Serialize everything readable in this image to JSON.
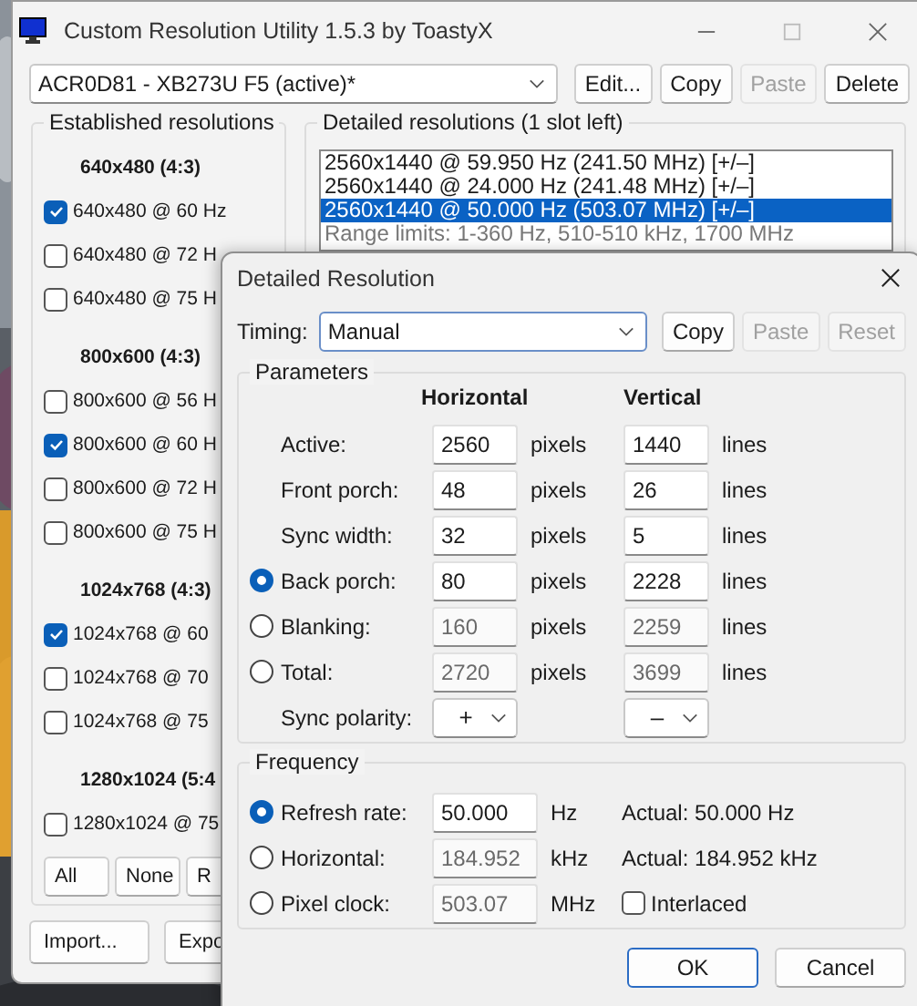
{
  "window": {
    "title": "Custom Resolution Utility 1.5.3 by ToastyX"
  },
  "monitor_select": {
    "value": "ACR0D81 - XB273U F5 (active)*"
  },
  "top_buttons": [
    {
      "label": "Edit...",
      "disabled": false
    },
    {
      "label": "Copy",
      "disabled": false
    },
    {
      "label": "Paste",
      "disabled": true
    },
    {
      "label": "Delete",
      "disabled": false
    }
  ],
  "established": {
    "title": "Established resolutions",
    "groups": [
      {
        "heading": "640x480 (4:3)",
        "items": [
          {
            "label": "640x480 @ 60 Hz",
            "checked": true
          },
          {
            "label": "640x480 @ 72 H",
            "checked": false
          },
          {
            "label": "640x480 @ 75 H",
            "checked": false
          }
        ]
      },
      {
        "heading": "800x600 (4:3)",
        "items": [
          {
            "label": "800x600 @ 56 H",
            "checked": false
          },
          {
            "label": "800x600 @ 60 H",
            "checked": true
          },
          {
            "label": "800x600 @ 72 H",
            "checked": false
          },
          {
            "label": "800x600 @ 75 H",
            "checked": false
          }
        ]
      },
      {
        "heading": "1024x768 (4:3)",
        "items": [
          {
            "label": "1024x768 @ 60",
            "checked": true
          },
          {
            "label": "1024x768 @ 70",
            "checked": false
          },
          {
            "label": "1024x768 @ 75",
            "checked": false
          }
        ]
      },
      {
        "heading": "1280x1024 (5:4",
        "items": [
          {
            "label": "1280x1024 @ 75",
            "checked": false
          }
        ]
      }
    ],
    "buttons": [
      {
        "label": "All"
      },
      {
        "label": "None"
      },
      {
        "label": "R"
      }
    ]
  },
  "detailed": {
    "title": "Detailed resolutions (1 slot left)",
    "items": [
      {
        "label": "2560x1440 @ 59.950 Hz (241.50 MHz) [+/–]",
        "selected": false
      },
      {
        "label": "2560x1440 @ 24.000 Hz (241.48 MHz) [+/–]",
        "selected": false
      },
      {
        "label": "2560x1440 @ 50.000 Hz (503.07 MHz) [+/–]",
        "selected": true
      }
    ],
    "range_limits": "Range limits: 1-360 Hz, 510-510 kHz, 1700 MHz"
  },
  "bottom_buttons": [
    {
      "label": "Import..."
    },
    {
      "label": "Expo"
    }
  ],
  "dialog": {
    "title": "Detailed Resolution",
    "timing": {
      "label": "Timing:",
      "value": "Manual"
    },
    "timing_buttons": [
      {
        "label": "Copy",
        "disabled": false
      },
      {
        "label": "Paste",
        "disabled": true
      },
      {
        "label": "Reset",
        "disabled": true
      }
    ],
    "parameters": {
      "title": "Parameters",
      "columns": [
        "Horizontal",
        "Vertical"
      ],
      "rows": [
        {
          "kind": "plain",
          "label": "Active:",
          "h": "2560",
          "h_unit": "pixels",
          "v": "1440",
          "v_unit": "lines",
          "disabled": false
        },
        {
          "kind": "plain",
          "label": "Front porch:",
          "h": "48",
          "h_unit": "pixels",
          "v": "26",
          "v_unit": "lines",
          "disabled": false
        },
        {
          "kind": "plain",
          "label": "Sync width:",
          "h": "32",
          "h_unit": "pixels",
          "v": "5",
          "v_unit": "lines",
          "disabled": false
        },
        {
          "kind": "radio",
          "selected": true,
          "label": "Back porch:",
          "h": "80",
          "h_unit": "pixels",
          "v": "2228",
          "v_unit": "lines",
          "disabled": false
        },
        {
          "kind": "radio",
          "selected": false,
          "label": "Blanking:",
          "h": "160",
          "h_unit": "pixels",
          "v": "2259",
          "v_unit": "lines",
          "disabled": true
        },
        {
          "kind": "radio",
          "selected": false,
          "label": "Total:",
          "h": "2720",
          "h_unit": "pixels",
          "v": "3699",
          "v_unit": "lines",
          "disabled": true
        }
      ],
      "sync_polarity": {
        "label": "Sync polarity:",
        "h": "+",
        "v": "–"
      }
    },
    "frequency": {
      "title": "Frequency",
      "rows": [
        {
          "kind": "actual",
          "label": "Refresh rate:",
          "selected": true,
          "value": "50.000",
          "unit": "Hz",
          "disabled": false,
          "actual": "Actual: 50.000 Hz"
        },
        {
          "kind": "actual",
          "label": "Horizontal:",
          "selected": false,
          "value": "184.952",
          "unit": "kHz",
          "disabled": true,
          "actual": "Actual: 184.952 kHz"
        },
        {
          "kind": "checkbox",
          "label": "Pixel clock:",
          "selected": false,
          "value": "503.07",
          "unit": "MHz",
          "disabled": true,
          "checkbox": {
            "label": "Interlaced",
            "checked": false
          }
        }
      ]
    },
    "buttons": [
      {
        "label": "OK",
        "default": true
      },
      {
        "label": "Cancel",
        "default": false
      }
    ]
  }
}
